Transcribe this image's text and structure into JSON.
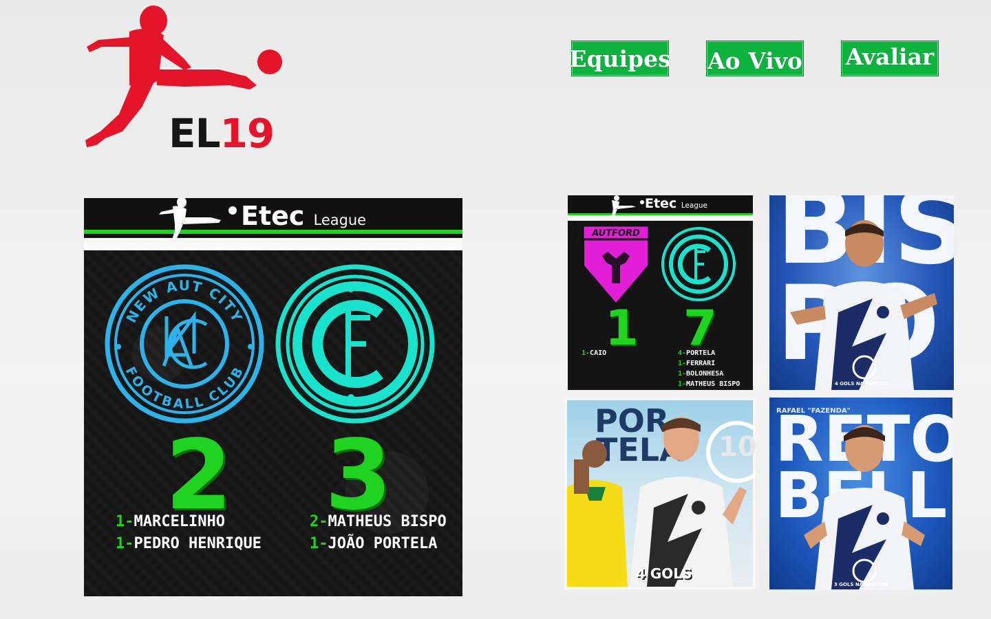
{
  "brand": {
    "logo_text_part1": "EL",
    "logo_text_part2": "19"
  },
  "nav": {
    "items": [
      "Equipes",
      "Ao Vivo",
      "Avaliar"
    ]
  },
  "colors": {
    "nav_green": "#0eb33d",
    "brand_red": "#e4142a",
    "score_green": "#1fd320"
  },
  "main_card": {
    "banner_title": "Etec",
    "banner_sub": "League",
    "home_team": {
      "crest_top": "NEW AUT CITY",
      "crest_bottom": "FOOTBALL CLUB",
      "score": "2"
    },
    "away_team": {
      "score": "3"
    },
    "home_scorers": [
      {
        "count": "1-",
        "name": "MARCELINHO"
      },
      {
        "count": "1-",
        "name": "PEDRO HENRIQUE"
      }
    ],
    "away_scorers": [
      {
        "count": "2-",
        "name": "MATHEUS BISPO"
      },
      {
        "count": "1-",
        "name": "JOÃO PORTELA"
      }
    ]
  },
  "thumb_match": {
    "banner_title": "Etec",
    "banner_sub": "League",
    "home_team": {
      "name": "AUTFORD",
      "score": "1"
    },
    "away_team": {
      "score": "7"
    },
    "home_scorers": [
      {
        "count": "1-",
        "name": "CAIO"
      }
    ],
    "away_scorers": [
      {
        "count": "4-",
        "name": "PORTELA"
      },
      {
        "count": "1-",
        "name": "FERRARI"
      },
      {
        "count": "1-",
        "name": "BOLONHESA"
      },
      {
        "count": "1-",
        "name": "MATHEUS BISPO"
      }
    ]
  },
  "thumb_bispo": {
    "bg_line1": "BIS",
    "bg_line2": "PO",
    "caption": "4 GOLS NA PARTIDA"
  },
  "thumb_portela": {
    "bg_line1": "POR",
    "bg_line2": "TELA",
    "number": "10",
    "caption": "4 GOLS"
  },
  "thumb_rafael": {
    "top_label": "RAFAEL \"FAZENDA\"",
    "bg_line1": "RETO",
    "bg_line2": "BELLI",
    "caption": "3 GOLS NA PARTIDA"
  }
}
